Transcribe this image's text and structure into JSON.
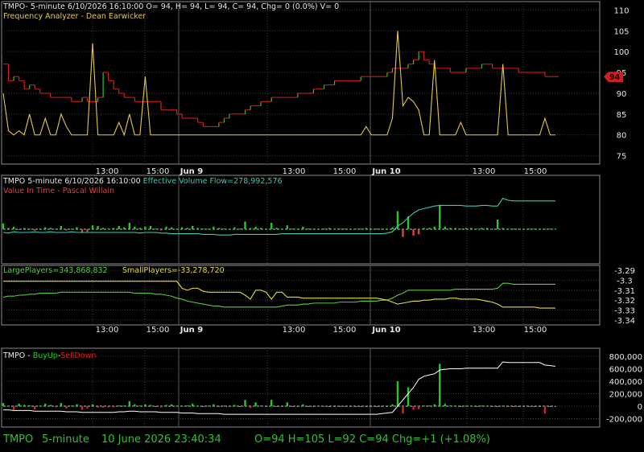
{
  "colors": {
    "background": "#000000",
    "grid": "#3a3a3a",
    "border": "#8c8c8c",
    "axis_text": "#e6e6e6",
    "up": "#28c828",
    "down": "#d82020",
    "price_line": "#c01818",
    "frequency": "#e6c84a",
    "effective_volume": "#3cc8b4",
    "value_in_time": "#e04040",
    "large_players": "#5acd3c",
    "small_players": "#e6dc3c",
    "buyup": "#28c828",
    "selldown": "#e02020",
    "white_line": "#ffffff",
    "price_tag": "#e01818",
    "status_text": "#30c030"
  },
  "panel1": {
    "header": "TMPO- 5-minute 6/10/2026 16:10:00 O= 94, H= 94, L= 94, C= 94, Chg= 0 (0.0%) V= 0",
    "subheader": "Frequency Analyzer - Dean Earwicker",
    "price_tag": "94"
  },
  "panel2": {
    "header_prefix": "TMPO 5-minute  6/10/2026 16:10:00  ",
    "header_indicator": "Effective Volume Flow=278,992,576",
    "subheader": "Value In Time - Pascal Willain"
  },
  "panel3": {
    "large": "LargePlayers=343,868,832",
    "small": "SmallPlayers=-33,278,720"
  },
  "panel4": {
    "header_prefix": "TMPO - ",
    "buyup": "BuyUp",
    "dash": "-",
    "selldown": "SellDown"
  },
  "time_axis": {
    "labels": [
      "13:00",
      "15:00",
      "Jun 9",
      "13:00",
      "15:00",
      "Jun 10",
      "13:00",
      "15:00"
    ]
  },
  "status_bar": {
    "symbol": "TMPO",
    "interval": "5-minute",
    "datetime": "10 June 2026 23:40:34",
    "ohlc": "O=94   H=105   L=92   C=94   Chg=+1 (+1.08%)"
  },
  "chart_data": [
    {
      "type": "line",
      "title": "Frequency Analyzer - Dean Earwicker",
      "ylim": [
        73,
        112
      ],
      "yticks": [
        75,
        80,
        85,
        90,
        95,
        100,
        105,
        110
      ],
      "series": [
        {
          "name": "TMPO",
          "style": "step-price",
          "values": [
            97,
            93,
            94,
            93,
            91,
            92,
            91,
            90,
            90,
            89,
            89,
            89,
            89,
            88,
            88,
            89,
            88,
            88,
            89,
            95,
            93,
            91,
            90,
            89,
            89,
            88,
            88,
            88,
            88,
            88,
            86,
            86,
            86,
            85,
            84,
            84,
            84,
            83,
            82,
            82,
            82,
            83,
            84,
            85,
            85,
            85,
            86,
            87,
            87,
            88,
            88,
            89,
            89,
            89,
            89,
            89,
            90,
            90,
            90,
            91,
            91,
            92,
            92,
            93,
            93,
            93,
            93,
            93,
            94,
            94,
            94,
            94,
            94,
            95,
            96,
            96,
            96,
            97,
            98,
            100,
            98,
            97,
            96,
            96,
            96,
            95,
            95,
            95,
            96,
            96,
            96,
            97,
            97,
            96,
            96,
            96,
            96,
            96,
            95,
            95,
            95,
            95,
            95,
            94,
            94,
            94
          ]
        },
        {
          "name": "Frequency Analyzer",
          "style": "spike",
          "values": [
            90,
            81,
            80,
            81,
            80,
            85,
            80,
            80,
            84,
            80,
            80,
            85,
            82,
            80,
            80,
            80,
            80,
            102,
            80,
            80,
            80,
            80,
            83,
            80,
            85,
            80,
            80,
            94,
            80,
            80,
            80,
            80,
            80,
            80,
            80,
            80,
            80,
            80,
            80,
            80,
            80,
            80,
            80,
            80,
            80,
            80,
            80,
            80,
            80,
            80,
            80,
            80,
            80,
            80,
            80,
            80,
            80,
            80,
            80,
            80,
            80,
            80,
            80,
            80,
            80,
            80,
            80,
            80,
            80,
            82,
            80,
            80,
            80,
            80,
            84,
            105,
            87,
            89,
            88,
            86,
            80,
            80,
            98,
            80,
            80,
            80,
            80,
            83,
            80,
            80,
            80,
            80,
            80,
            80,
            80,
            97,
            80,
            80,
            80,
            80,
            80,
            80,
            80,
            84,
            80,
            80
          ]
        }
      ]
    },
    {
      "type": "line",
      "title": "Effective Volume Flow / Value In Time",
      "series": [
        {
          "name": "Effective Volume Flow",
          "values": [
            -0.05,
            -0.06,
            -0.04,
            -0.05,
            -0.05,
            -0.05,
            -0.04,
            -0.05,
            -0.05,
            -0.04,
            -0.05,
            -0.05,
            -0.05,
            -0.04,
            -0.05,
            -0.05,
            -0.05,
            -0.05,
            -0.05,
            -0.05,
            -0.05,
            -0.05,
            -0.05,
            -0.05,
            -0.05,
            -0.05,
            -0.06,
            -0.05,
            -0.05,
            -0.05,
            -0.06,
            -0.06,
            -0.07,
            -0.07,
            -0.07,
            -0.07,
            -0.07,
            -0.07,
            -0.08,
            -0.08,
            -0.08,
            -0.09,
            -0.09,
            -0.09,
            -0.08,
            -0.08,
            -0.08,
            -0.08,
            -0.08,
            -0.08,
            -0.08,
            -0.08,
            -0.08,
            -0.07,
            -0.07,
            -0.07,
            -0.07,
            -0.07,
            -0.07,
            -0.07,
            -0.07,
            -0.07,
            -0.07,
            -0.07,
            -0.07,
            -0.07,
            -0.07,
            -0.07,
            -0.07,
            -0.07,
            -0.07,
            -0.07,
            -0.07,
            -0.06,
            -0.04,
            0.05,
            0.1,
            0.18,
            0.25,
            0.3,
            0.32,
            0.34,
            0.36,
            0.37,
            0.37,
            0.37,
            0.37,
            0.37,
            0.36,
            0.36,
            0.36,
            0.37,
            0.37,
            0.36,
            0.36,
            0.48,
            0.45,
            0.44,
            0.44,
            0.44,
            0.44,
            0.44,
            0.44,
            0.44,
            0.44,
            0.44
          ]
        },
        {
          "name": "Volume",
          "values": [
            0.09,
            0.02,
            0.04,
            -0.01,
            0.02,
            0.01,
            -0.02,
            0.01,
            0.03,
            0.02,
            0.01,
            0.05,
            -0.02,
            0.01,
            0.03,
            -0.05,
            -0.04,
            0.06,
            0.05,
            0.02,
            0.01,
            0.02,
            0.05,
            0.03,
            0.1,
            0.04,
            0.02,
            0.04,
            0.05,
            0.01,
            -0.02,
            0.04,
            0.03,
            0.01,
            0.03,
            0.02,
            0.05,
            0.02,
            0.01,
            0.01,
            0.04,
            0.02,
            0.01,
            0.01,
            0.03,
            0.01,
            0.12,
            0.02,
            0.04,
            0.02,
            0.01,
            0.1,
            0.02,
            0.01,
            0.06,
            0.01,
            0.01,
            0.04,
            0.01,
            0.01,
            0.01,
            0.01,
            0.02,
            0.01,
            0.01,
            0.01,
            0.01,
            0.01,
            0.01,
            0.02,
            0.01,
            0.01,
            0.01,
            0.01,
            0.03,
            0.28,
            -0.12,
            0.2,
            -0.1,
            -0.08,
            0.02,
            0.02,
            0.04,
            0.38,
            0.04,
            0.02,
            0.02,
            0.01,
            0.02,
            0.02,
            0.01,
            0.02,
            0.02,
            0.01,
            0.15,
            0.02,
            0.01,
            0.01,
            0.01,
            0.01,
            0.01,
            0.01,
            0.01,
            0.01,
            0.01,
            0.01
          ]
        }
      ]
    },
    {
      "type": "line",
      "title": "LargePlayers / SmallPlayers",
      "ylim": [
        -3.345,
        -3.285
      ],
      "yticks": [
        -3.29,
        -3.3,
        -3.31,
        -3.32,
        -3.33,
        -3.34
      ],
      "series": [
        {
          "name": "LargePlayers",
          "values": [
            -3.317,
            -3.316,
            -3.316,
            -3.315,
            -3.315,
            -3.314,
            -3.314,
            -3.313,
            -3.313,
            -3.313,
            -3.313,
            -3.312,
            -3.312,
            -3.312,
            -3.312,
            -3.312,
            -3.312,
            -3.312,
            -3.312,
            -3.312,
            -3.312,
            -3.312,
            -3.312,
            -3.312,
            -3.312,
            -3.313,
            -3.313,
            -3.313,
            -3.313,
            -3.314,
            -3.314,
            -3.315,
            -3.316,
            -3.318,
            -3.319,
            -3.321,
            -3.322,
            -3.323,
            -3.324,
            -3.325,
            -3.326,
            -3.326,
            -3.327,
            -3.327,
            -3.327,
            -3.327,
            -3.327,
            -3.327,
            -3.327,
            -3.327,
            -3.327,
            -3.327,
            -3.327,
            -3.326,
            -3.325,
            -3.325,
            -3.325,
            -3.324,
            -3.324,
            -3.323,
            -3.323,
            -3.323,
            -3.323,
            -3.323,
            -3.322,
            -3.322,
            -3.322,
            -3.322,
            -3.321,
            -3.321,
            -3.321,
            -3.321,
            -3.32,
            -3.32,
            -3.318,
            -3.315,
            -3.313,
            -3.31,
            -3.31,
            -3.31,
            -3.31,
            -3.31,
            -3.31,
            -3.31,
            -3.31,
            -3.31,
            -3.309,
            -3.309,
            -3.309,
            -3.309,
            -3.309,
            -3.309,
            -3.309,
            -3.309,
            -3.308,
            -3.303,
            -3.303,
            -3.304,
            -3.304,
            -3.304,
            -3.304,
            -3.304,
            -3.304,
            -3.304,
            -3.304,
            -3.304
          ]
        },
        {
          "name": "SmallPlayers",
          "values": [
            -3.301,
            -3.301,
            -3.301,
            -3.301,
            -3.301,
            -3.301,
            -3.301,
            -3.301,
            -3.301,
            -3.301,
            -3.301,
            -3.301,
            -3.301,
            -3.301,
            -3.301,
            -3.301,
            -3.301,
            -3.301,
            -3.301,
            -3.301,
            -3.301,
            -3.301,
            -3.301,
            -3.301,
            -3.301,
            -3.301,
            -3.301,
            -3.301,
            -3.301,
            -3.301,
            -3.301,
            -3.301,
            -3.301,
            -3.301,
            -3.308,
            -3.31,
            -3.308,
            -3.308,
            -3.311,
            -3.312,
            -3.312,
            -3.312,
            -3.312,
            -3.312,
            -3.312,
            -3.312,
            -3.315,
            -3.319,
            -3.31,
            -3.31,
            -3.312,
            -3.319,
            -3.312,
            -3.312,
            -3.317,
            -3.317,
            -3.317,
            -3.318,
            -3.318,
            -3.318,
            -3.318,
            -3.318,
            -3.318,
            -3.318,
            -3.318,
            -3.318,
            -3.318,
            -3.318,
            -3.318,
            -3.318,
            -3.318,
            -3.318,
            -3.319,
            -3.32,
            -3.322,
            -3.324,
            -3.323,
            -3.322,
            -3.321,
            -3.321,
            -3.32,
            -3.32,
            -3.319,
            -3.319,
            -3.319,
            -3.318,
            -3.318,
            -3.319,
            -3.319,
            -3.319,
            -3.319,
            -3.32,
            -3.321,
            -3.322,
            -3.324,
            -3.327,
            -3.327,
            -3.327,
            -3.327,
            -3.327,
            -3.327,
            -3.327,
            -3.328,
            -3.328,
            -3.328,
            -3.328
          ]
        }
      ]
    },
    {
      "type": "bar",
      "title": "BuyUp-SellDown",
      "ylim": [
        -300000,
        900000
      ],
      "yticks": [
        800000,
        600000,
        400000,
        200000,
        0,
        -200000
      ],
      "ytick_labels": [
        "800,000",
        "600,000",
        "400,000",
        "200,000",
        "0",
        "-200,000"
      ],
      "series": [
        {
          "name": "BuyUp-SellDown",
          "values": [
            50000,
            10000,
            -60000,
            40000,
            20000,
            15000,
            -50000,
            10000,
            40000,
            20000,
            -20000,
            50000,
            -40000,
            10000,
            30000,
            -60000,
            -40000,
            30000,
            -25000,
            -25000,
            -20000,
            -20000,
            10000,
            10000,
            80000,
            30000,
            10000,
            30000,
            20000,
            0,
            -20000,
            20000,
            30000,
            10000,
            10000,
            10000,
            40000,
            10000,
            0,
            10000,
            30000,
            0,
            10000,
            0,
            20000,
            0,
            100000,
            -30000,
            60000,
            10000,
            0,
            100000,
            0,
            0,
            60000,
            0,
            0,
            30000,
            0,
            0,
            10000,
            -10000,
            0,
            0,
            0,
            0,
            0,
            0,
            0,
            0,
            0,
            0,
            0,
            0,
            30000,
            400000,
            -120000,
            300000,
            -60000,
            -50000,
            10000,
            10000,
            30000,
            680000,
            40000,
            10000,
            10000,
            0,
            10000,
            10000,
            0,
            10000,
            10000,
            0,
            0,
            10000,
            0,
            0,
            0,
            0,
            0,
            0,
            0,
            -120000,
            0,
            0
          ]
        },
        {
          "name": "Cumulative",
          "values": [
            -60000,
            -60000,
            -70000,
            -70000,
            -70000,
            -70000,
            -80000,
            -80000,
            -80000,
            -80000,
            -80000,
            -80000,
            -90000,
            -90000,
            -90000,
            -100000,
            -100000,
            -100000,
            -100000,
            -100000,
            -100000,
            -100000,
            -90000,
            -90000,
            -80000,
            -80000,
            -90000,
            -90000,
            -90000,
            -90000,
            -100000,
            -100000,
            -100000,
            -100000,
            -110000,
            -110000,
            -110000,
            -120000,
            -120000,
            -120000,
            -120000,
            -120000,
            -130000,
            -130000,
            -130000,
            -130000,
            -130000,
            -130000,
            -130000,
            -130000,
            -130000,
            -130000,
            -130000,
            -130000,
            -130000,
            -130000,
            -130000,
            -130000,
            -130000,
            -130000,
            -130000,
            -130000,
            -130000,
            -130000,
            -130000,
            -130000,
            -130000,
            -130000,
            -130000,
            -130000,
            -130000,
            -130000,
            -120000,
            -110000,
            -100000,
            0,
            100000,
            200000,
            300000,
            430000,
            480000,
            500000,
            520000,
            580000,
            590000,
            600000,
            600000,
            600000,
            610000,
            610000,
            610000,
            610000,
            610000,
            610000,
            610000,
            710000,
            700000,
            700000,
            700000,
            700000,
            700000,
            700000,
            700000,
            660000,
            650000,
            640000
          ]
        }
      ]
    }
  ]
}
